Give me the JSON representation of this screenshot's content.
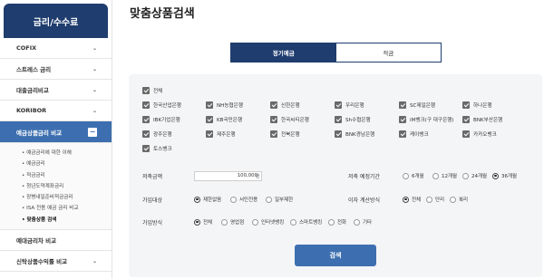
{
  "sidebar": {
    "title": "금리/수수료",
    "items_top": [
      {
        "label": "COFIX"
      },
      {
        "label": "스트레스 금리"
      },
      {
        "label": "대출금리비교"
      },
      {
        "label": "KORIBOR"
      }
    ],
    "active_item": {
      "label": "예금상품금리 비교",
      "toggle": "−"
    },
    "sub_items": [
      {
        "label": "예금금리에 대한 이해"
      },
      {
        "label": "예금금리"
      },
      {
        "label": "적금금리"
      },
      {
        "label": "청년도약계좌금리"
      },
      {
        "label": "장병내일준비적금금리"
      },
      {
        "label": "ISA 전용 예금 금리 비교"
      },
      {
        "label": "맞춤상품 검색"
      }
    ],
    "items_bottom": [
      {
        "label": "예대금리차 비교"
      },
      {
        "label": "신탁상품수익률 비교"
      }
    ],
    "chevron": "⌄"
  },
  "page": {
    "title": "맞춤상품검색"
  },
  "tabs": [
    {
      "label": "정기예금"
    },
    {
      "label": "적금"
    }
  ],
  "banks": {
    "all_label": "전체",
    "list": [
      "한국산업은행",
      "NH농협은행",
      "신한은행",
      "우리은행",
      "SC제일은행",
      "하나은행",
      "IBK기업은행",
      "KB국민은행",
      "한국씨티은행",
      "Sh수협은행",
      "iM뱅크(구 대구은행)",
      "BNK부산은행",
      "광주은행",
      "제주은행",
      "전북은행",
      "BNK경남은행",
      "케이뱅크",
      "카카오뱅크",
      "토스뱅크"
    ]
  },
  "filters": {
    "amount_label": "저축금액",
    "amount_value": "100,000",
    "amount_unit": "원",
    "period_label": "저축 예정기간",
    "period_options": [
      "6개월",
      "12개월",
      "24개월",
      "36개월"
    ],
    "period_selected": "36개월",
    "target_label": "가입대상",
    "target_options": [
      "제한없음",
      "서민전용",
      "일부제한"
    ],
    "target_selected": "제한없음",
    "interest_label": "이자 계산방식",
    "interest_options": [
      "전체",
      "단리",
      "복리"
    ],
    "interest_selected": "전체",
    "method_label": "가입방식",
    "method_options": [
      "전체",
      "영업점",
      "인터넷뱅킹",
      "스마트뱅킹",
      "전화",
      "기타"
    ],
    "method_selected": "전체"
  },
  "search_button": "검색"
}
